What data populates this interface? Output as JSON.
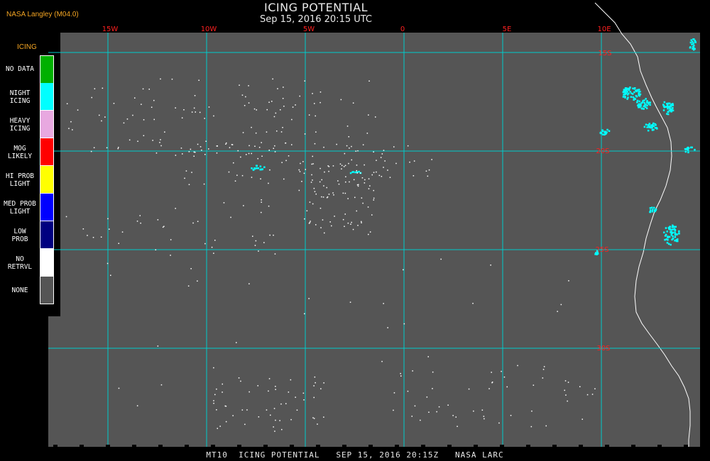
{
  "header": {
    "credit": "NASA Langley (M04.0)",
    "title": "ICING POTENTIAL",
    "subtitle": "Sep 15, 2016 20:15 UTC"
  },
  "legend": {
    "title": "ICING",
    "items": [
      {
        "label_lines": [
          "NO DATA"
        ],
        "color": "#00b000"
      },
      {
        "label_lines": [
          "NIGHT",
          "ICING"
        ],
        "color": "#00ffff"
      },
      {
        "label_lines": [
          "HEAVY",
          "ICING"
        ],
        "color": "#e8a8e0"
      },
      {
        "label_lines": [
          "MOG",
          "LIKELY"
        ],
        "color": "#ff0000"
      },
      {
        "label_lines": [
          "HI PROB",
          "LIGHT"
        ],
        "color": "#ffff00"
      },
      {
        "label_lines": [
          "MED PROB",
          "LIGHT"
        ],
        "color": "#0000ff"
      },
      {
        "label_lines": [
          "LOW",
          "PROB"
        ],
        "color": "#000080"
      },
      {
        "label_lines": [
          "NO",
          "RETRVL"
        ],
        "color": "#ffffff"
      },
      {
        "label_lines": [
          "NONE"
        ],
        "color": "#555555"
      }
    ]
  },
  "map": {
    "longitude_labels": [
      "15W",
      "10W",
      "5W",
      "0",
      "5E",
      "10E"
    ],
    "latitude_labels": [
      "15S",
      "20S",
      "25S",
      "30S"
    ],
    "background_color": "#555555",
    "grid_color": "#00cccc",
    "label_color": "#ff2020"
  },
  "footer": {
    "text": "MT10  ICING POTENTIAL   SEP 15, 2016 20:15Z   NASA LARC"
  }
}
